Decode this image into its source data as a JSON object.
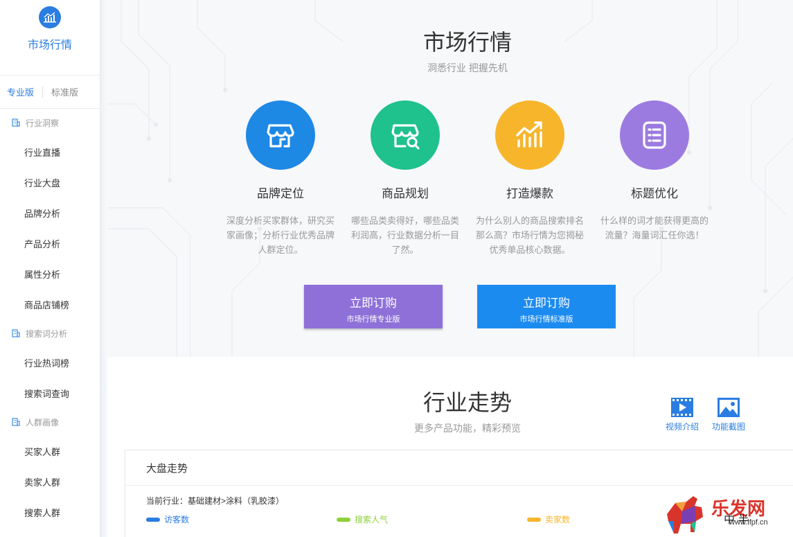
{
  "sidebar": {
    "app_title": "市场行情",
    "logo_icon": "market-chart-icon",
    "tabs": [
      {
        "label": "专业版",
        "active": true
      },
      {
        "label": "标准版",
        "active": false
      }
    ],
    "sections": [
      {
        "title": "行业洞察",
        "items": [
          "行业直播",
          "行业大盘",
          "品牌分析",
          "产品分析",
          "属性分析",
          "商品店铺榜"
        ]
      },
      {
        "title": "搜索词分析",
        "items": [
          "行业热词榜",
          "搜索词查询"
        ]
      },
      {
        "title": "人群画像",
        "items": [
          "买家人群",
          "卖家人群",
          "搜索人群"
        ]
      }
    ]
  },
  "hero": {
    "title": "市场行情",
    "subtitle": "洞悉行业 把握先机",
    "features": [
      {
        "name": "品牌定位",
        "desc": "深度分析买家群体，研究买家画像；分析行业优秀品牌人群定位。",
        "color": "#1e88e5",
        "icon": "store-icon"
      },
      {
        "name": "商品规划",
        "desc": "哪些品类卖得好，哪些品类利润高，行业数据分析一目了然。",
        "color": "#1fc18d",
        "icon": "store-search-icon"
      },
      {
        "name": "打造爆款",
        "desc": "为什么别人的商品搜索排名那么高？市场行情为您揭秘优秀单品核心数据。",
        "color": "#f7b52c",
        "icon": "trend-bars-icon"
      },
      {
        "name": "标题优化",
        "desc": "什么样的词才能获得更高的流量？海量词汇任你选！",
        "color": "#9c7be0",
        "icon": "list-icon"
      }
    ],
    "buttons": [
      {
        "label": "立即订购",
        "sub": "市场行情专业版"
      },
      {
        "label": "立即订购",
        "sub": "市场行情标准版"
      }
    ]
  },
  "trend": {
    "title": "行业走势",
    "subtitle": "更多产品功能，精彩预览",
    "tools": [
      {
        "label": "视频介绍",
        "icon": "video-icon"
      },
      {
        "label": "功能截图",
        "icon": "image-icon"
      }
    ],
    "panel": {
      "title": "大盘走势",
      "industry": "当前行业：基础建材>涂料（乳胶漆）",
      "legend": [
        {
          "label": "访客数",
          "color": "#2a7de1"
        },
        {
          "label": "搜索人气",
          "color": "#8dd13a"
        },
        {
          "label": "卖家数",
          "color": "#f7b52c"
        }
      ]
    }
  },
  "watermark": {
    "text": "乐发网",
    "url": "www.lfpf.cn",
    "extra": "中 半"
  }
}
